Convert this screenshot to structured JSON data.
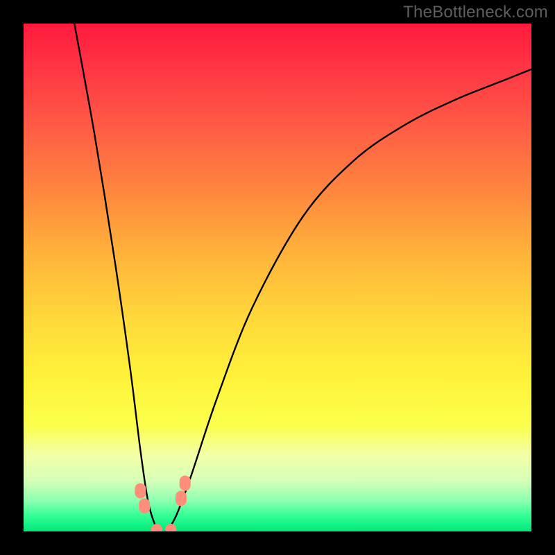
{
  "watermark": "TheBottleneck.com",
  "gradient_colors": {
    "top": "#ff1a3c",
    "mid_upper": "#ff8a3e",
    "mid": "#fff33a",
    "mid_lower": "#d6ffb8",
    "bottom": "#00e87a"
  },
  "chart_data": {
    "type": "line",
    "title": "",
    "xlabel": "",
    "ylabel": "",
    "xlim": [
      0,
      100
    ],
    "ylim": [
      0,
      100
    ],
    "grid": false,
    "legend": false,
    "series": [
      {
        "name": "bottleneck-curve",
        "x": [
          10,
          14,
          18,
          21,
          23,
          24.5,
          26,
          27,
          28,
          30,
          33,
          38,
          45,
          55,
          65,
          75,
          85,
          95,
          100
        ],
        "y": [
          100,
          78,
          53,
          32,
          16,
          6,
          1,
          0,
          0,
          3,
          11,
          26,
          44,
          62,
          73,
          80,
          85,
          89,
          91
        ],
        "color": "#000000"
      }
    ],
    "markers": [
      {
        "name": "pt-left-upper",
        "x": 23.0,
        "y": 8.0,
        "color": "#ff8f7a"
      },
      {
        "name": "pt-left-lower",
        "x": 23.8,
        "y": 5.0,
        "color": "#ff8f7a"
      },
      {
        "name": "pt-bottom-left",
        "x": 26.2,
        "y": 0.0,
        "color": "#ff8f7a"
      },
      {
        "name": "pt-bottom-right",
        "x": 29.0,
        "y": 0.0,
        "color": "#ff8f7a"
      },
      {
        "name": "pt-right-lower",
        "x": 31.0,
        "y": 6.5,
        "color": "#ff8f7a"
      },
      {
        "name": "pt-right-upper",
        "x": 31.8,
        "y": 9.5,
        "color": "#ff8f7a"
      }
    ]
  }
}
